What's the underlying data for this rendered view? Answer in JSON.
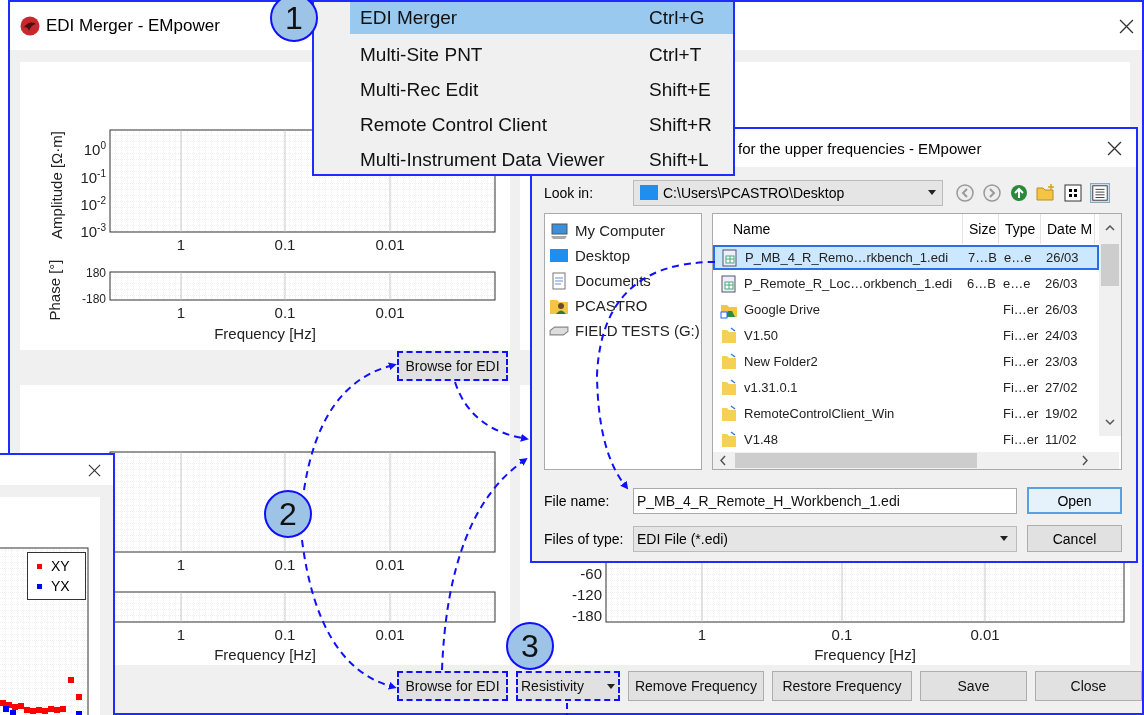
{
  "main_window": {
    "title": "EDI Merger - EMpower"
  },
  "upper_plot": {
    "amplitude_label": "Amplitude [Ω·m]",
    "amplitude_yticks": [
      "10$^{0}$",
      "10$^{-1}$",
      "10$^{-2}$",
      "10$^{-3}$"
    ],
    "amplitude_xticks": [
      "1",
      "0.1",
      "0.01"
    ],
    "phase_label": "Phase [°]",
    "phase_yticks": [
      "180",
      "-180"
    ],
    "phase_xticks": [
      "1",
      "0.1",
      "0.01"
    ],
    "xlabel": "Frequency [Hz]"
  },
  "upper_browse_button": {
    "label": "Browse for EDI",
    "highlighted": true
  },
  "lower_plot": {
    "amplitude_xticks": [
      "1",
      "0.1",
      "0.01"
    ],
    "phase_xticks": [
      "1",
      "0.1",
      "0.01"
    ],
    "xlabel": "Frequency [Hz]"
  },
  "right_plot": {
    "phase_yticks": [
      "-60",
      "-120",
      "-180"
    ],
    "phase_xticks": [
      "1",
      "0.1",
      "0.01"
    ],
    "xlabel": "Frequency [Hz]"
  },
  "bottom_bar": {
    "browse_button": {
      "label": "Browse for EDI",
      "highlighted": true
    },
    "mode_dropdown": {
      "value": "Resistivity",
      "highlighted": true
    },
    "buttons": [
      "Remove Frequency",
      "Restore Frequency",
      "Save",
      "Close"
    ]
  },
  "tools_menu": {
    "items": [
      {
        "label": "EDI Merger",
        "shortcut": "Ctrl+G",
        "selected": true
      },
      {
        "label": "Multi-Site PNT",
        "shortcut": "Ctrl+T",
        "selected": false
      },
      {
        "label": "Multi-Rec Edit",
        "shortcut": "Shift+E",
        "selected": false
      },
      {
        "label": "Remote Control Client",
        "shortcut": "Shift+R",
        "selected": false
      },
      {
        "label": "Multi-Instrument Data Viewer",
        "shortcut": "Shift+L",
        "selected": false
      }
    ]
  },
  "file_dialog": {
    "title": "for the upper frequencies - EMpower",
    "look_in_label": "Look in:",
    "look_in_path": "C:\\Users\\PCASTRO\\Desktop",
    "places": [
      {
        "label": "My Computer",
        "kind": "computer"
      },
      {
        "label": "Desktop",
        "kind": "desktop"
      },
      {
        "label": "Documents",
        "kind": "documents"
      },
      {
        "label": "PCASTRO",
        "kind": "user"
      },
      {
        "label": "FIELD TESTS (G:)",
        "kind": "drive"
      }
    ],
    "columns": [
      "Name",
      "Size",
      "Type",
      "Date M"
    ],
    "files": [
      {
        "name": "P_MB_4_R_Remo…rkbench_1.edi",
        "size": "7…B",
        "type": "e…e",
        "date": "26/03",
        "kind": "edi",
        "selected": true
      },
      {
        "name": "P_Remote_R_Loc…orkbench_1.edi",
        "size": "6…B",
        "type": "e…e",
        "date": "26/03",
        "kind": "edi",
        "selected": false
      },
      {
        "name": "Google Drive",
        "type": "Fi…er",
        "date": "26/03",
        "kind": "cloud",
        "selected": false
      },
      {
        "name": "V1.50",
        "type": "Fi…er",
        "date": "24/03",
        "kind": "folder",
        "selected": false
      },
      {
        "name": "New Folder2",
        "type": "Fi…er",
        "date": "23/03",
        "kind": "folder",
        "selected": false
      },
      {
        "name": "v1.31.0.1",
        "type": "Fi…er",
        "date": "27/02",
        "kind": "folder",
        "selected": false
      },
      {
        "name": "RemoteControlClient_Win",
        "type": "Fi…er",
        "date": "19/02",
        "kind": "folder",
        "selected": false
      },
      {
        "name": "V1.48",
        "type": "Fi…er",
        "date": "11/02",
        "kind": "folder",
        "selected": false
      }
    ],
    "file_name_label": "File name:",
    "file_name": "P_MB_4_R_Remote_H_Workbench_1.edi",
    "file_type_label": "Files of type:",
    "file_type": "EDI File (*.edi)",
    "open_button": "Open",
    "cancel_button": "Cancel"
  },
  "side_window": {
    "legend": [
      {
        "label": "XY",
        "color": "#ff0000"
      },
      {
        "label": "YX",
        "color": "#0000ff"
      }
    ]
  },
  "callouts": [
    "1",
    "2",
    "3"
  ]
}
